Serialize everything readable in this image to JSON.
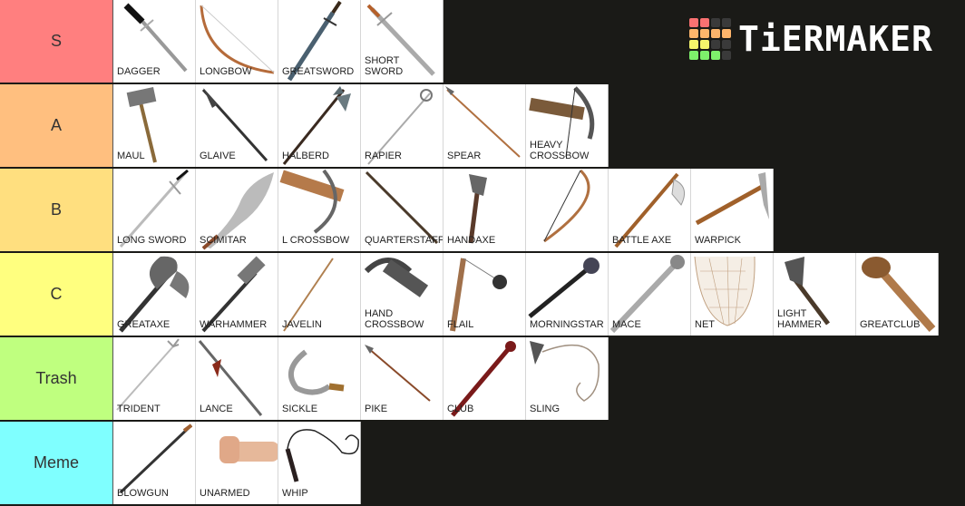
{
  "logo": {
    "text": "TiERMAKER",
    "grid": [
      "#f97171",
      "#f97171",
      "#3a3a3a",
      "#3a3a3a",
      "#fdb56b",
      "#fdb56b",
      "#fdb56b",
      "#fdb56b",
      "#f5f56b",
      "#f5f56b",
      "#3a3a3a",
      "#3a3a3a",
      "#7ef06b",
      "#7ef06b",
      "#7ef06b",
      "#3a3a3a"
    ]
  },
  "tiers": [
    {
      "label": "S",
      "color": "#ff7f7f",
      "items": [
        {
          "label": "DAGGER",
          "icon": "dagger-icon"
        },
        {
          "label": "LONGBOW",
          "icon": "longbow-icon"
        },
        {
          "label": "GREATSWORD",
          "icon": "greatsword-icon"
        },
        {
          "label": "SHORT\nSWORD",
          "icon": "short-sword-icon"
        }
      ]
    },
    {
      "label": "A",
      "color": "#ffbf7f",
      "items": [
        {
          "label": "MAUL",
          "icon": "maul-icon"
        },
        {
          "label": "GLAIVE",
          "icon": "glaive-icon"
        },
        {
          "label": "HALBERD",
          "icon": "halberd-icon"
        },
        {
          "label": "RAPIER",
          "icon": "rapier-icon"
        },
        {
          "label": "SPEAR",
          "icon": "spear-icon"
        },
        {
          "label": "HEAVY\nCROSSBOW",
          "icon": "heavy-crossbow-icon"
        }
      ]
    },
    {
      "label": "B",
      "color": "#ffdf7f",
      "items": [
        {
          "label": "LONG SWORD",
          "icon": "long-sword-icon"
        },
        {
          "label": "SCIMITAR",
          "icon": "scimitar-icon"
        },
        {
          "label": "L CROSSBOW",
          "icon": "light-crossbow-icon"
        },
        {
          "label": "QUARTERSTAFF",
          "icon": "quarterstaff-icon"
        },
        {
          "label": "HANDAXE",
          "icon": "handaxe-icon"
        },
        {
          "label": "",
          "icon": "shortbow-icon"
        },
        {
          "label": "BATTLE AXE",
          "icon": "battle-axe-icon"
        },
        {
          "label": "WARPICK",
          "icon": "warpick-icon"
        }
      ]
    },
    {
      "label": "C",
      "color": "#ffff7f",
      "items": [
        {
          "label": "GREATAXE",
          "icon": "greataxe-icon"
        },
        {
          "label": "WARHAMMER",
          "icon": "warhammer-icon"
        },
        {
          "label": "JAVELIN",
          "icon": "javelin-icon"
        },
        {
          "label": "HAND\nCROSSBOW",
          "icon": "hand-crossbow-icon"
        },
        {
          "label": "FLAIL",
          "icon": "flail-icon"
        },
        {
          "label": "MORNINGSTAR",
          "icon": "morningstar-icon"
        },
        {
          "label": "MACE",
          "icon": "mace-icon"
        },
        {
          "label": "NET",
          "icon": "net-icon"
        },
        {
          "label": "LIGHT HAMMER",
          "icon": "light-hammer-icon"
        },
        {
          "label": "GREATCLUB",
          "icon": "greatclub-icon"
        }
      ]
    },
    {
      "label": "Trash",
      "color": "#bfff7f",
      "items": [
        {
          "label": "TRIDENT",
          "icon": "trident-icon"
        },
        {
          "label": "LANCE",
          "icon": "lance-icon"
        },
        {
          "label": "SICKLE",
          "icon": "sickle-icon"
        },
        {
          "label": "PIKE",
          "icon": "pike-icon"
        },
        {
          "label": "CLUB",
          "icon": "club-icon"
        },
        {
          "label": "SLING",
          "icon": "sling-icon"
        }
      ]
    },
    {
      "label": "Meme",
      "color": "#7fffff",
      "items": [
        {
          "label": "BLOWGUN",
          "icon": "blowgun-icon"
        },
        {
          "label": "UNARMED",
          "icon": "fist-icon"
        },
        {
          "label": "WHIP",
          "icon": "whip-icon"
        }
      ]
    }
  ]
}
